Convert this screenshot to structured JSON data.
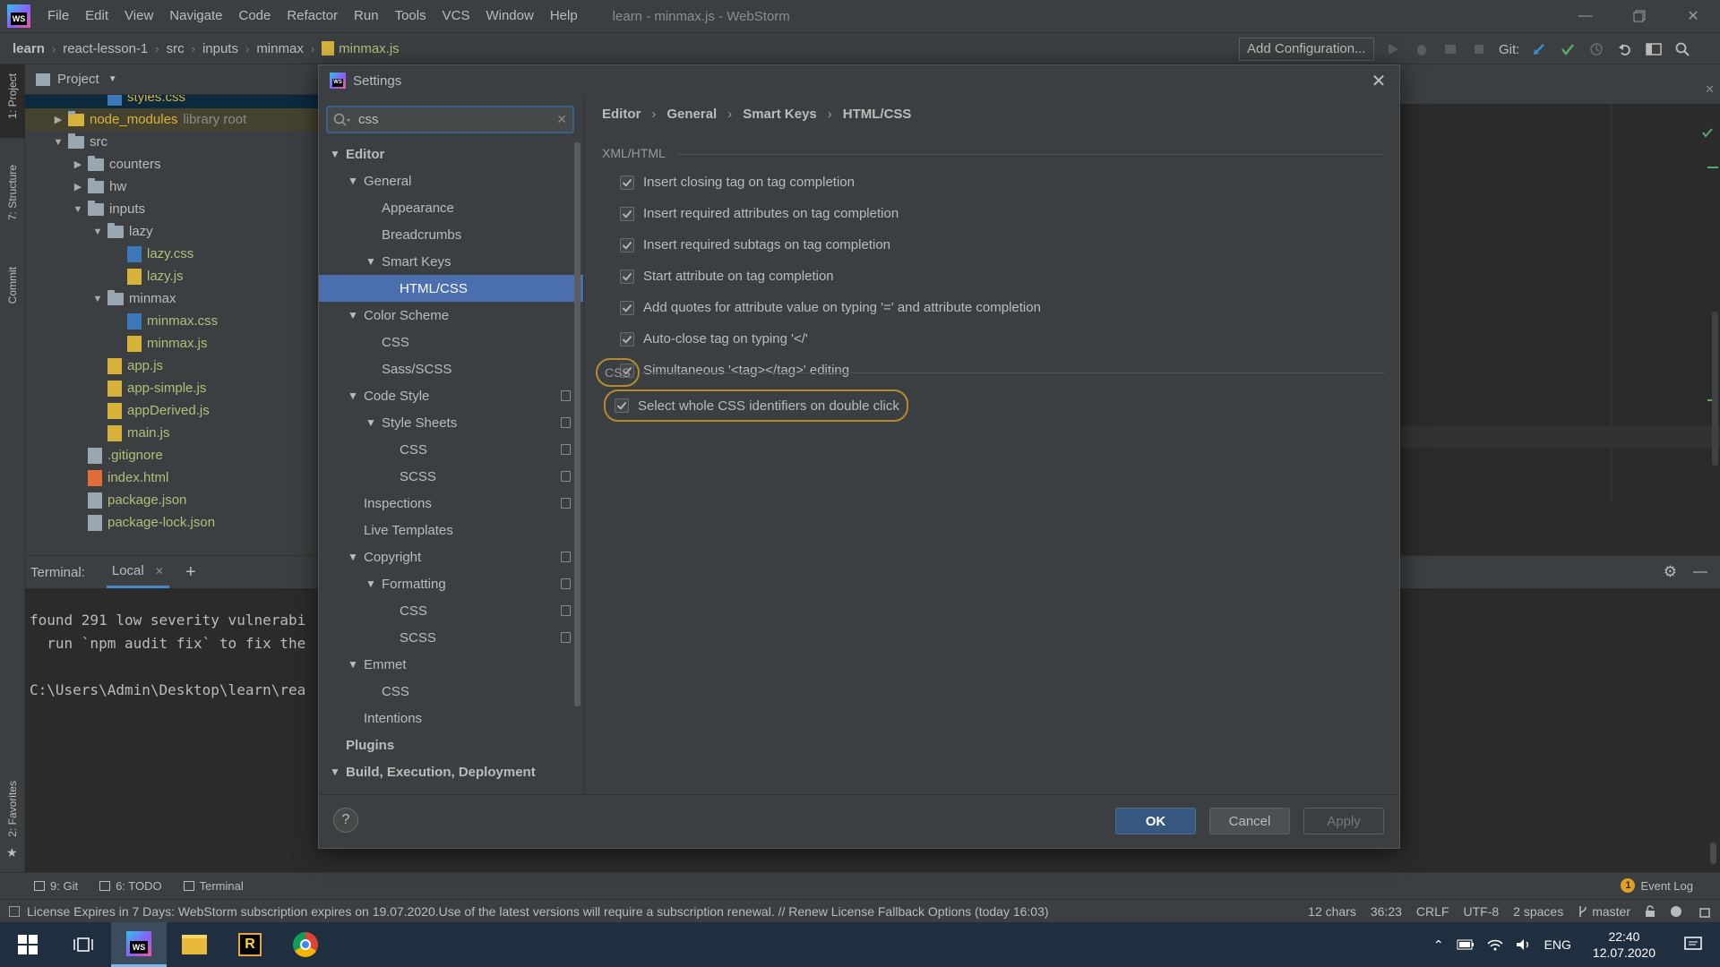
{
  "menu": [
    "File",
    "Edit",
    "View",
    "Navigate",
    "Code",
    "Refactor",
    "Run",
    "Tools",
    "VCS",
    "Window",
    "Help"
  ],
  "window_title": "learn - minmax.js - WebStorm",
  "logo_text": "WS",
  "breadcrumbs": [
    "learn",
    "react-lesson-1",
    "src",
    "inputs",
    "minmax",
    "minmax.js"
  ],
  "toolbar": {
    "add_configuration": "Add Configuration...",
    "git_label": "Git:"
  },
  "left_strip": {
    "project": "1: Project",
    "structure": "7: Structure",
    "commit": "Commit",
    "favorites": "2: Favorites"
  },
  "project_panel": {
    "title": "Project",
    "rows": [
      {
        "label": "styles.css",
        "type": "css",
        "depth": 4,
        "style": "selected"
      },
      {
        "label": "node_modules",
        "suffix": "library root",
        "type": "folder",
        "depth": 2,
        "arrow": "▶",
        "style": "library"
      },
      {
        "label": "src",
        "type": "folder",
        "depth": 2,
        "arrow": "▼"
      },
      {
        "label": "counters",
        "type": "folder",
        "depth": 3,
        "arrow": "▶"
      },
      {
        "label": "hw",
        "type": "folder",
        "depth": 3,
        "arrow": "▶"
      },
      {
        "label": "inputs",
        "type": "folder",
        "depth": 3,
        "arrow": "▼"
      },
      {
        "label": "lazy",
        "type": "folder",
        "depth": 4,
        "arrow": "▼"
      },
      {
        "label": "lazy.css",
        "type": "css",
        "depth": 5
      },
      {
        "label": "lazy.js",
        "type": "js",
        "depth": 5
      },
      {
        "label": "minmax",
        "type": "folder",
        "depth": 4,
        "arrow": "▼"
      },
      {
        "label": "minmax.css",
        "type": "css",
        "depth": 5
      },
      {
        "label": "minmax.js",
        "type": "js",
        "depth": 5
      },
      {
        "label": "app.js",
        "type": "js",
        "depth": 4
      },
      {
        "label": "app-simple.js",
        "type": "js",
        "depth": 4
      },
      {
        "label": "appDerived.js",
        "type": "js",
        "depth": 4
      },
      {
        "label": "main.js",
        "type": "js",
        "depth": 4
      },
      {
        "label": ".gitignore",
        "type": "git",
        "depth": 3
      },
      {
        "label": "index.html",
        "type": "html",
        "depth": 3
      },
      {
        "label": "package.json",
        "type": "json",
        "depth": 3
      },
      {
        "label": "package-lock.json",
        "type": "json",
        "depth": 3
      }
    ]
  },
  "terminal": {
    "label": "Terminal:",
    "tab": "Local",
    "lines": [
      "found 291 low severity vulnerabi",
      "  run `npm audit fix` to fix the",
      "",
      "C:\\Users\\Admin\\Desktop\\learn\\rea"
    ]
  },
  "bottom_tabs": [
    "9: Git",
    "6: TODO",
    "Terminal"
  ],
  "event_log": {
    "badge": "1",
    "label": "Event Log"
  },
  "status": {
    "message": "License Expires in 7 Days: WebStorm subscription expires on 19.07.2020.Use of the latest versions will require a subscription renewal. // Renew License   Fallback Options (today 16:03)",
    "chars": "12 chars",
    "position": "36:23",
    "line_sep": "CRLF",
    "encoding": "UTF-8",
    "indent": "2 spaces",
    "branch": "master"
  },
  "taskbar": {
    "lang": "ENG",
    "time": "22:40",
    "date": "12.07.2020"
  },
  "dialog": {
    "title": "Settings",
    "search_value": "css",
    "tree": [
      {
        "label": "Editor",
        "depth": 0,
        "arrow": "▼",
        "bold": true
      },
      {
        "label": "General",
        "depth": 1,
        "arrow": "▼"
      },
      {
        "label": "Appearance",
        "depth": 2
      },
      {
        "label": "Breadcrumbs",
        "depth": 2
      },
      {
        "label": "Smart Keys",
        "depth": 2,
        "arrow": "▼"
      },
      {
        "label": "HTML/CSS",
        "depth": 3,
        "selected": true
      },
      {
        "label": "Color Scheme",
        "depth": 1,
        "arrow": "▼"
      },
      {
        "label": "CSS",
        "depth": 2
      },
      {
        "label": "Sass/SCSS",
        "depth": 2
      },
      {
        "label": "Code Style",
        "depth": 1,
        "arrow": "▼",
        "copy": true
      },
      {
        "label": "Style Sheets",
        "depth": 2,
        "arrow": "▼",
        "copy": true
      },
      {
        "label": "CSS",
        "depth": 3,
        "copy": true
      },
      {
        "label": "SCSS",
        "depth": 3,
        "copy": true
      },
      {
        "label": "Inspections",
        "depth": 1,
        "copy": true
      },
      {
        "label": "Live Templates",
        "depth": 1
      },
      {
        "label": "Copyright",
        "depth": 1,
        "arrow": "▼",
        "copy": true
      },
      {
        "label": "Formatting",
        "depth": 2,
        "arrow": "▼",
        "copy": true
      },
      {
        "label": "CSS",
        "depth": 3,
        "copy": true
      },
      {
        "label": "SCSS",
        "depth": 3,
        "copy": true
      },
      {
        "label": "Emmet",
        "depth": 1,
        "arrow": "▼"
      },
      {
        "label": "CSS",
        "depth": 2
      },
      {
        "label": "Intentions",
        "depth": 1
      },
      {
        "label": "Plugins",
        "depth": 0,
        "bold": true
      },
      {
        "label": "Build, Execution, Deployment",
        "depth": 0,
        "arrow": "▼",
        "bold": true
      }
    ],
    "breadcrumb": [
      "Editor",
      "General",
      "Smart Keys",
      "HTML/CSS"
    ],
    "xml_group": "XML/HTML",
    "xml_options": [
      "Insert closing tag on tag completion",
      "Insert required attributes on tag completion",
      "Insert required subtags on tag completion",
      "Start attribute on tag completion",
      "Add quotes for attribute value on typing '=' and attribute completion",
      "Auto-close tag on typing '</'",
      "Simultaneous '<tag></tag>' editing"
    ],
    "css_group": "CSS",
    "css_options": [
      "Select whole CSS identifiers on double click"
    ],
    "buttons": {
      "help": "?",
      "ok": "OK",
      "cancel": "Cancel",
      "apply": "Apply"
    }
  }
}
